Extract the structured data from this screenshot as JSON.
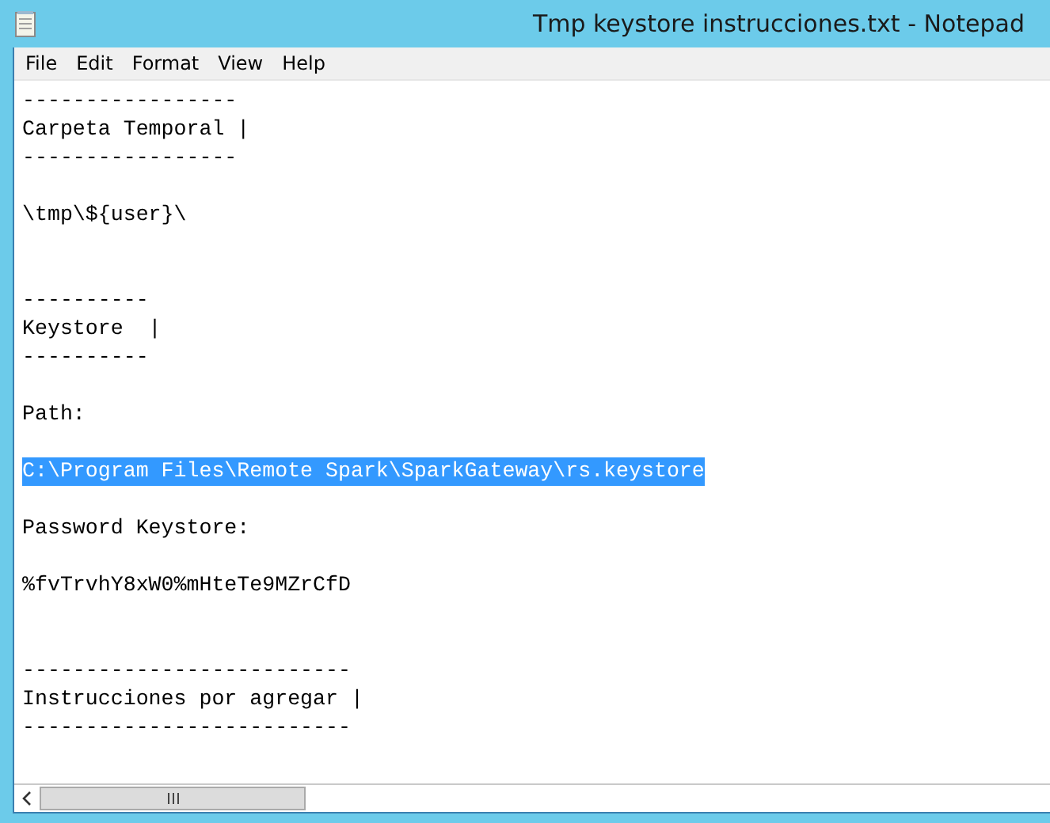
{
  "window": {
    "title": "Tmp keystore instrucciones.txt - Notepad"
  },
  "menu": [
    "File",
    "Edit",
    "Format",
    "View",
    "Help"
  ],
  "lines": [
    {
      "kind": "text",
      "text": "-----------------",
      "selected": false
    },
    {
      "kind": "text",
      "text": "Carpeta Temporal |",
      "selected": false
    },
    {
      "kind": "text",
      "text": "-----------------",
      "selected": false
    },
    {
      "kind": "blank"
    },
    {
      "kind": "text",
      "text": "\\tmp\\${user}\\",
      "selected": false
    },
    {
      "kind": "blank"
    },
    {
      "kind": "blank"
    },
    {
      "kind": "text",
      "text": "----------",
      "selected": false
    },
    {
      "kind": "text",
      "text": "Keystore  |",
      "selected": false
    },
    {
      "kind": "text",
      "text": "----------",
      "selected": false
    },
    {
      "kind": "blank"
    },
    {
      "kind": "text",
      "text": "Path:",
      "selected": false
    },
    {
      "kind": "blank"
    },
    {
      "kind": "text",
      "text": "C:\\Program Files\\Remote Spark\\SparkGateway\\rs.keystore",
      "selected": true
    },
    {
      "kind": "blank"
    },
    {
      "kind": "text",
      "text": "Password Keystore:",
      "selected": false
    },
    {
      "kind": "blank"
    },
    {
      "kind": "text",
      "text": "%fvTrvhY8xW0%mHteTe9MZrCfD",
      "selected": false
    },
    {
      "kind": "blank"
    },
    {
      "kind": "blank"
    },
    {
      "kind": "text",
      "text": "--------------------------",
      "selected": false
    },
    {
      "kind": "text",
      "text": "Instrucciones por agregar |",
      "selected": false
    },
    {
      "kind": "text",
      "text": "--------------------------",
      "selected": false
    }
  ]
}
